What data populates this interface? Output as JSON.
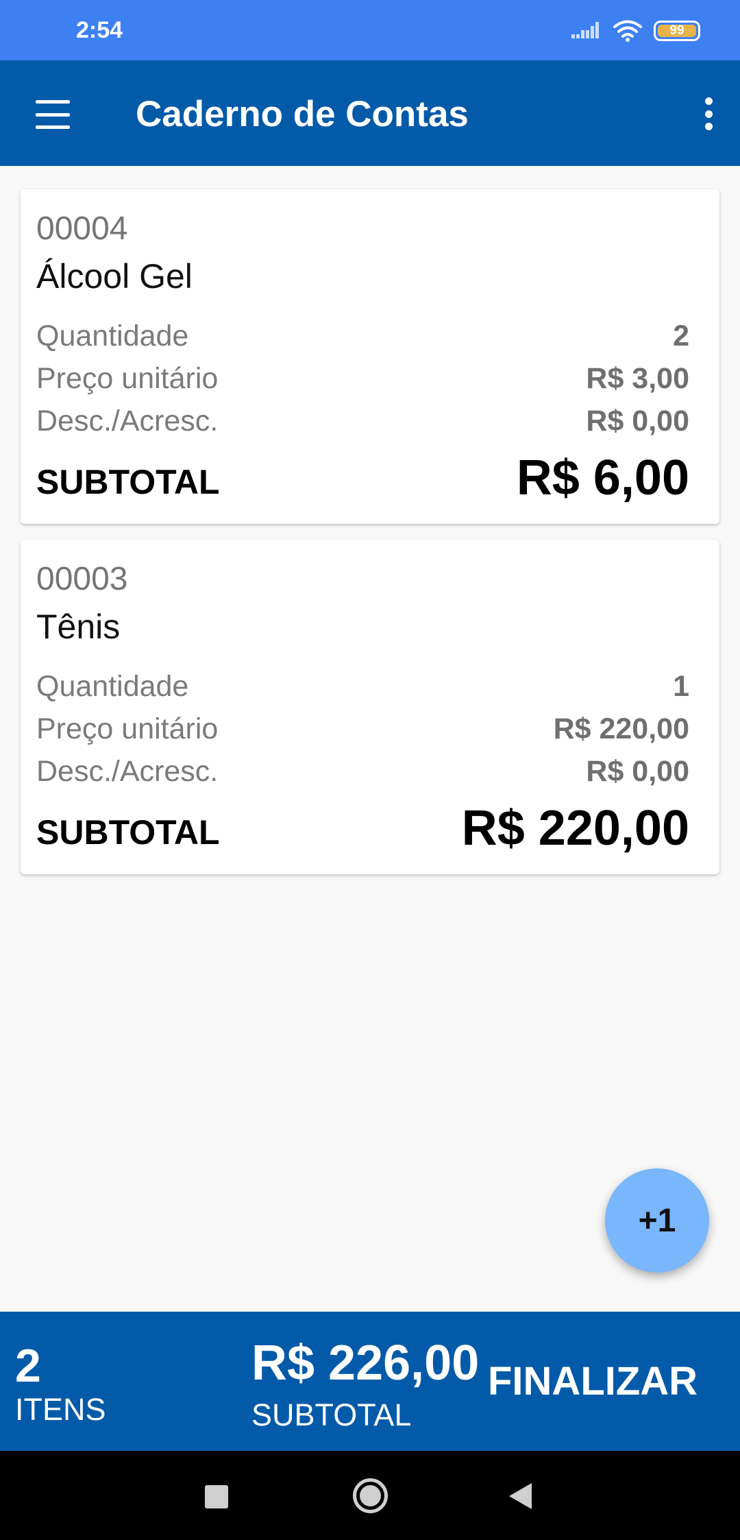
{
  "status_bar": {
    "time": "2:54",
    "battery_level": "99",
    "icons": [
      "signal-icon",
      "wifi-icon",
      "battery-icon"
    ]
  },
  "app_bar": {
    "title": "Caderno de Contas",
    "icons": [
      "menu-icon",
      "overflow-menu-icon"
    ]
  },
  "items": [
    {
      "code": "00004",
      "name": "Álcool Gel",
      "quantity_label": "Quantidade",
      "quantity": "2",
      "unit_price_label": "Preço unitário",
      "unit_price": "R$ 3,00",
      "discount_label": "Desc./Acresc.",
      "discount": "R$ 0,00",
      "subtotal_label": "SUBTOTAL",
      "subtotal": "R$ 6,00"
    },
    {
      "code": "00003",
      "name": "Tênis",
      "quantity_label": "Quantidade",
      "quantity": "1",
      "unit_price_label": "Preço unitário",
      "unit_price": "R$ 220,00",
      "discount_label": "Desc./Acresc.",
      "discount": "R$ 0,00",
      "subtotal_label": "SUBTOTAL",
      "subtotal": "R$ 220,00"
    }
  ],
  "fab": {
    "label": "+1"
  },
  "summary": {
    "item_count": "2",
    "item_count_label": "ITENS",
    "total": "R$ 226,00",
    "total_label": "SUBTOTAL",
    "finalize_label": "FINALIZAR"
  },
  "colors": {
    "status_bar": "#3d80f2",
    "primary": "#035aa8",
    "fab": "#79b6fb",
    "battery": "#e8b44a",
    "background": "#f8f8f8"
  }
}
